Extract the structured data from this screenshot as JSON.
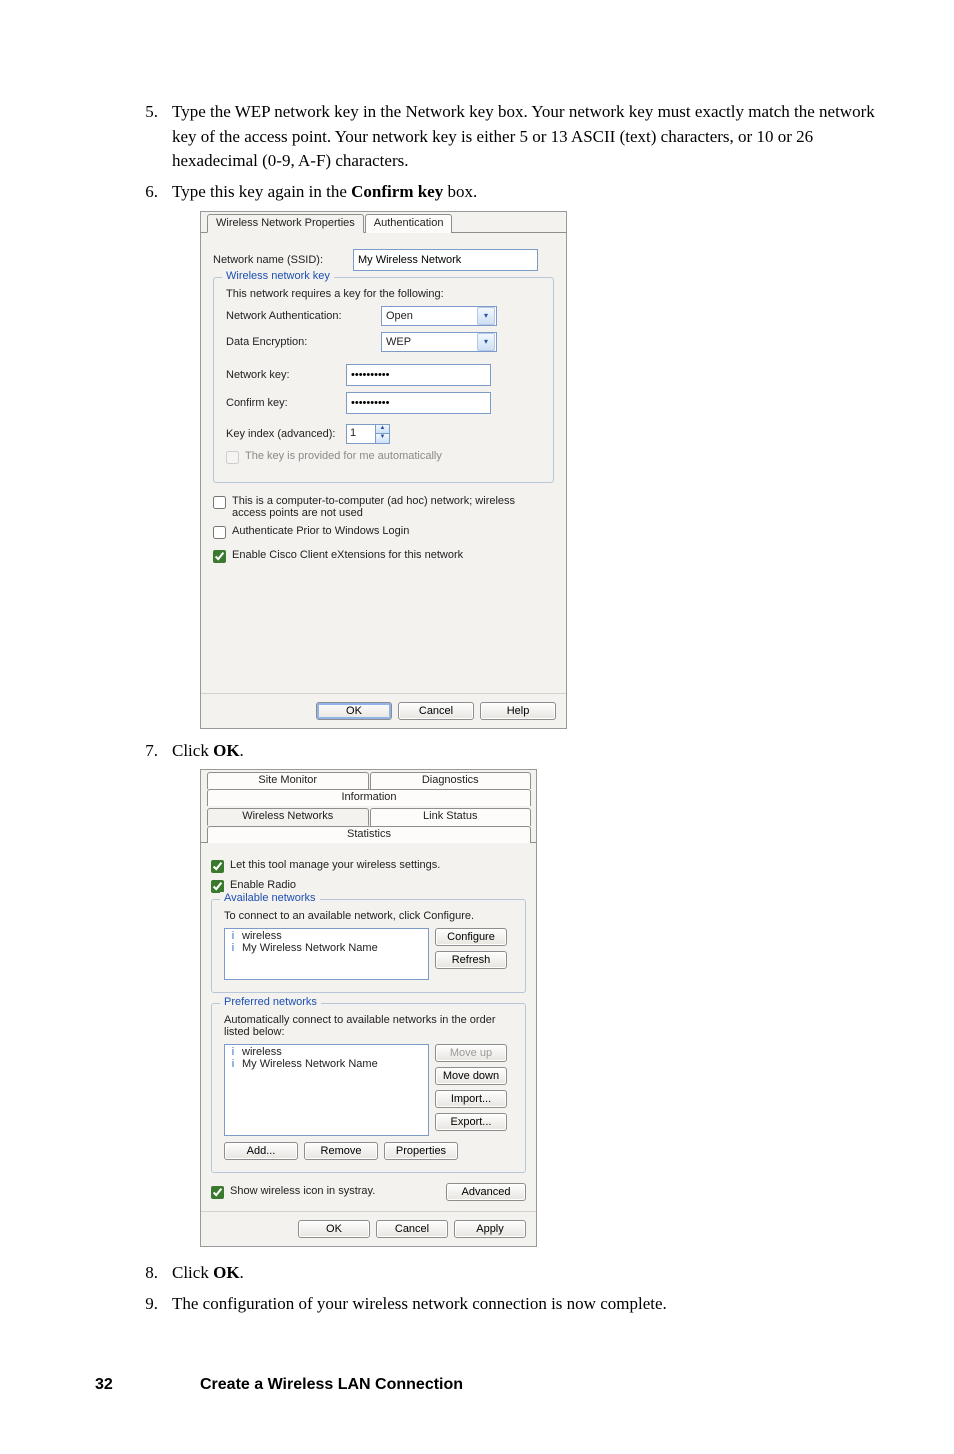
{
  "steps": {
    "s5": {
      "num": "5.",
      "text_a": "Type the WEP network key in the Network key box. Your network key must exactly match the network key of the access point. Your network key is either 5 or 13 ASCII (text) characters, or 10 or 26 hexadecimal (0-9, A-F) characters."
    },
    "s6": {
      "num": "6.",
      "text_a": "Type this key again in the ",
      "bold": "Confirm key",
      "text_b": " box."
    },
    "s7": {
      "num": "7.",
      "text_a": "Click ",
      "bold": "OK",
      "text_b": "."
    },
    "s8": {
      "num": "8.",
      "text_a": "Click ",
      "bold": "OK",
      "text_b": "."
    },
    "s9": {
      "num": "9.",
      "text_a": "The configuration of your wireless network connection is now complete."
    }
  },
  "dlg1": {
    "tab1": "Wireless Network Properties",
    "tab2": "Authentication",
    "ssid_label": "Network name (SSID):",
    "ssid_value": "My Wireless Network",
    "group_legend": "Wireless network key",
    "group_desc": "This network requires a key for the following:",
    "auth_label": "Network Authentication:",
    "auth_value": "Open",
    "enc_label": "Data Encryption:",
    "enc_value": "WEP",
    "key_label": "Network key:",
    "key_value": "••••••••••",
    "conf_label": "Confirm key:",
    "conf_value": "••••••••••",
    "idx_label": "Key index (advanced):",
    "idx_value": "1",
    "autokey": "The key is provided for me automatically",
    "adhoc": "This is a computer-to-computer (ad hoc) network; wireless access points are not used",
    "authprior": "Authenticate Prior to Windows Login",
    "cisco": "Enable Cisco Client eXtensions for this network",
    "btn_ok": "OK",
    "btn_cancel": "Cancel",
    "btn_help": "Help"
  },
  "dlg2": {
    "tabs": {
      "site": "Site Monitor",
      "diag": "Diagnostics",
      "info": "Information",
      "wnet": "Wireless Networks",
      "link": "Link Status",
      "stat": "Statistics"
    },
    "let_tool": "Let this tool manage your wireless settings.",
    "radio": "Enable Radio",
    "avail_legend": "Available networks",
    "avail_desc": "To connect to an available network, click Configure.",
    "avail_items": [
      "wireless",
      "My Wireless Network Name"
    ],
    "btn_configure": "Configure",
    "btn_refresh": "Refresh",
    "pref_legend": "Preferred networks",
    "pref_desc": "Automatically connect to available networks in the order listed below:",
    "pref_items": [
      "wireless",
      "My Wireless Network Name"
    ],
    "btn_moveup": "Move up",
    "btn_movedown": "Move down",
    "btn_import": "Import...",
    "btn_export": "Export...",
    "btn_add": "Add...",
    "btn_remove": "Remove",
    "btn_properties": "Properties",
    "systray": "Show wireless icon in systray.",
    "btn_advanced": "Advanced",
    "btn_ok": "OK",
    "btn_cancel": "Cancel",
    "btn_apply": "Apply"
  },
  "footer": {
    "page": "32",
    "chapter": "Create a Wireless LAN Connection"
  }
}
